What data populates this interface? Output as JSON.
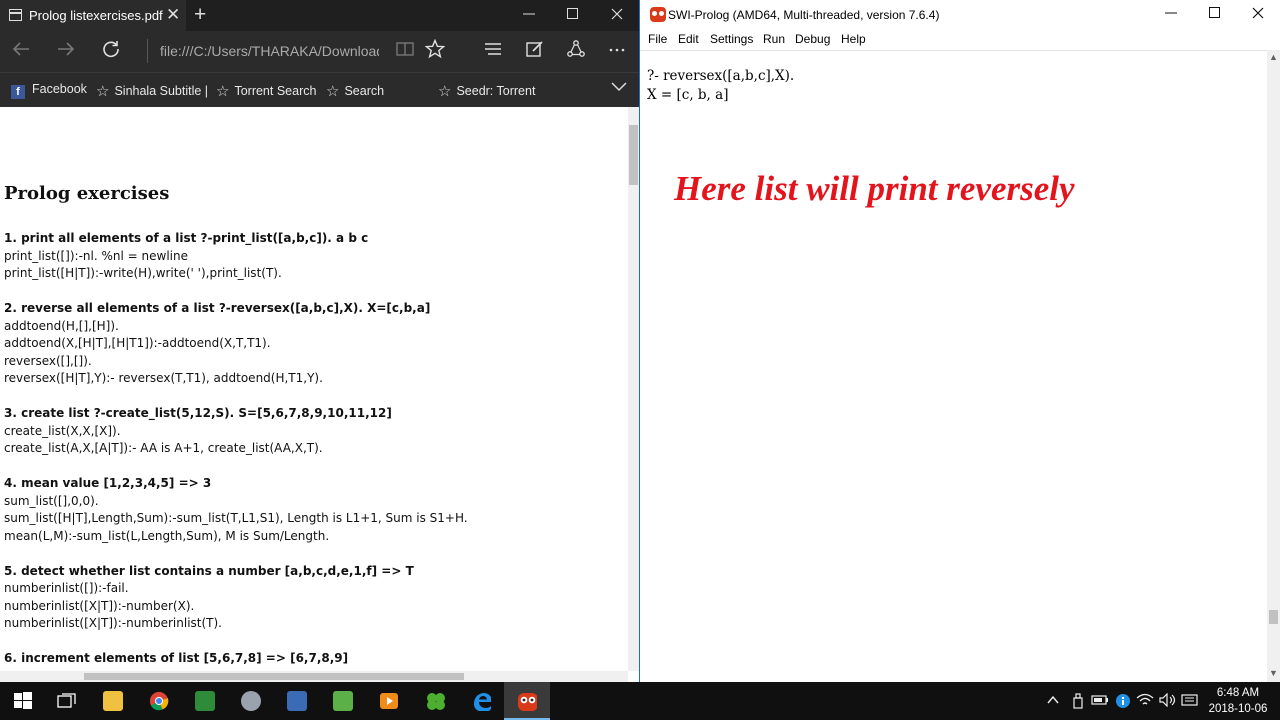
{
  "edge": {
    "tab_title": "Prolog listexercises.pdf",
    "tab_close": "✕",
    "new_tab": "+",
    "address": "file:///C:/Users/THARAKA/Downloads/Dc",
    "favorites": [
      {
        "label": "Facebook",
        "icon": "facebook-icon"
      },
      {
        "label": "Sinhala Subtitle |",
        "icon": "star-icon"
      },
      {
        "label": "Torrent Search",
        "icon": "star-icon"
      },
      {
        "label": "Search",
        "icon": "star-icon"
      },
      {
        "label": "Seedr: Torrent",
        "icon": "star-icon"
      }
    ],
    "pdf": {
      "title": "Prolog exercises",
      "sections": [
        {
          "heading": "1. print all elements of a list ?-print_list([a,b,c]). a b c",
          "lines": [
            "print_list([]):-nl. %nl = newline",
            "print_list([H|T]):-write(H),write(' '),print_list(T)."
          ]
        },
        {
          "heading": "2. reverse all elements of a list ?-reversex([a,b,c],X). X=[c,b,a]",
          "lines": [
            "addtoend(H,[],[H]).",
            "addtoend(X,[H|T],[H|T1]):-addtoend(X,T,T1).",
            "reversex([],[]).",
            "reversex([H|T],Y):- reversex(T,T1), addtoend(H,T1,Y)."
          ]
        },
        {
          "heading": "3. create list ?-create_list(5,12,S). S=[5,6,7,8,9,10,11,12]",
          "lines": [
            "create_list(X,X,[X]).",
            "create_list(A,X,[A|T]):- AA is A+1, create_list(AA,X,T)."
          ]
        },
        {
          "heading": "4. mean value [1,2,3,4,5] => 3",
          "lines": [
            "sum_list([],0,0).",
            "sum_list([H|T],Length,Sum):-sum_list(T,L1,S1), Length is L1+1, Sum is S1+H.",
            "mean(L,M):-sum_list(L,Length,Sum), M is Sum/Length."
          ]
        },
        {
          "heading": "5. detect whether list contains a number [a,b,c,d,e,1,f] => T",
          "lines": [
            "numberinlist([]):-fail.",
            "numberinlist([X|T]):-number(X).",
            "numberinlist([X|T]):-numberinlist(T)."
          ]
        },
        {
          "heading": "6. increment elements of list [5,6,7,8] => [6,7,8,9]",
          "lines": []
        }
      ]
    }
  },
  "swi": {
    "title": "SWI-Prolog (AMD64, Multi-threaded, version 7.6.4)",
    "menu": [
      "File",
      "Edit",
      "Settings",
      "Run",
      "Debug",
      "Help"
    ],
    "console": {
      "query": "?- reversex([a,b,c],X).",
      "result": "X = [c, b, a]"
    },
    "annotation": "Here list will print reversely",
    "annotation_color": "#e3141c"
  },
  "taskbar": {
    "apps": [
      "start-icon",
      "task-view-icon",
      "file-explorer-icon",
      "chrome-icon",
      "app-icon",
      "app-icon",
      "app-icon",
      "app-icon",
      "media-player-icon",
      "clover-icon",
      "edge-icon",
      "swi-prolog-icon"
    ],
    "time": "6:48 AM",
    "date": "2018-10-06"
  }
}
